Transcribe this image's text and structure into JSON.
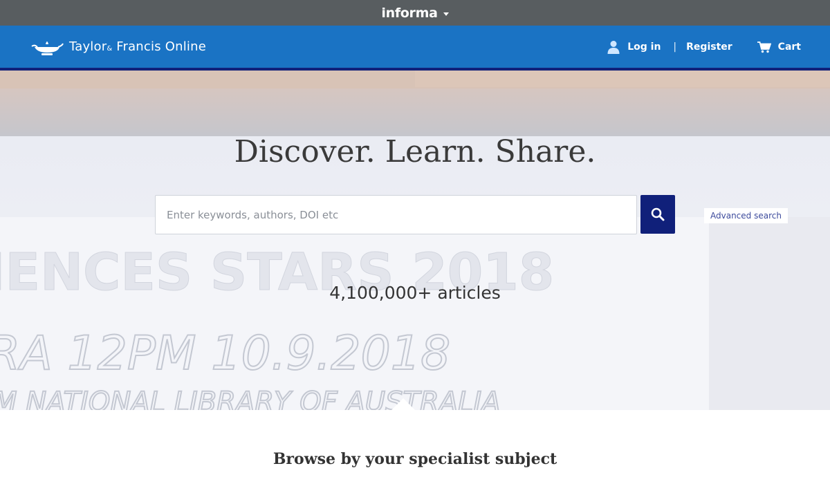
{
  "topbar": {
    "brand": "informa"
  },
  "header": {
    "logo_text_main": "Taylor",
    "logo_text_amp": "&",
    "logo_text_rest": " Francis Online",
    "nav": {
      "login": "Log in",
      "separator": "|",
      "register": "Register",
      "cart": "Cart"
    }
  },
  "hero": {
    "title": "Discover. Learn. Share.",
    "search": {
      "placeholder": "Enter keywords, authors, DOI etc",
      "value": ""
    },
    "advanced_search": "Advanced search",
    "article_count": "4,100,000+ articles",
    "background_text": {
      "line1": "IENCES STARS 2018",
      "line2": "RA  12PM  10.9.2018",
      "line3": "M  NATIONAL  LIBRARY  OF  AUSTRALIA"
    }
  },
  "browse": {
    "title": "Browse by your specialist subject"
  },
  "colors": {
    "informa_bar": "#585d60",
    "header_blue": "#1a73c4",
    "navy": "#10207a"
  }
}
